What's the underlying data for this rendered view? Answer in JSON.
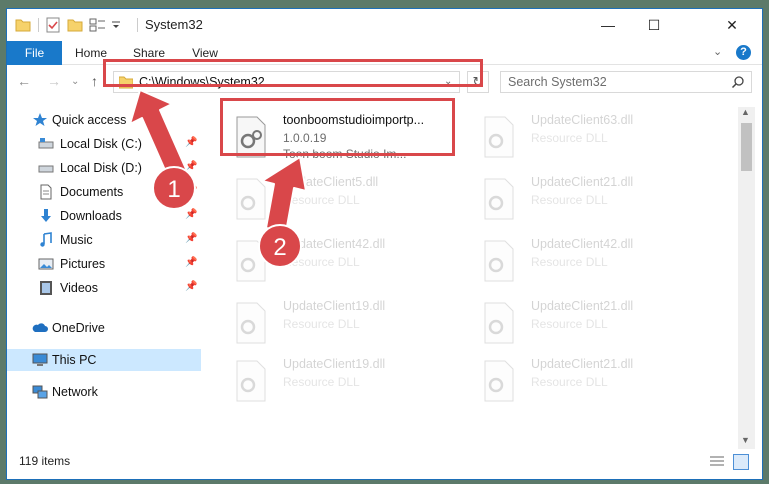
{
  "window": {
    "title": "System32",
    "minimize_glyph": "—",
    "maximize_glyph": "☐",
    "close_glyph": "✕"
  },
  "ribbon": {
    "tabs": [
      "File",
      "Home",
      "Share",
      "View"
    ],
    "collapse_glyph": "⌄",
    "help_glyph": "?"
  },
  "nav": {
    "back_glyph": "←",
    "forward_glyph": "→",
    "recent_glyph": "⌄",
    "up_glyph": "↑",
    "address": "C:\\Windows\\System32",
    "address_dropdown_glyph": "⌄",
    "refresh_glyph": "↻",
    "search_placeholder": "Search System32"
  },
  "sidebar": {
    "items": [
      {
        "label": "Quick access",
        "icon": "star-icon",
        "pinned": false
      },
      {
        "label": "Local Disk (C:)",
        "icon": "drive-icon",
        "pinned": true
      },
      {
        "label": "Local Disk (D:)",
        "icon": "drive-icon",
        "pinned": true
      },
      {
        "label": "Documents",
        "icon": "document-icon",
        "pinned": true
      },
      {
        "label": "Downloads",
        "icon": "download-icon",
        "pinned": true
      },
      {
        "label": "Music",
        "icon": "music-icon",
        "pinned": true
      },
      {
        "label": "Pictures",
        "icon": "picture-icon",
        "pinned": true
      },
      {
        "label": "Videos",
        "icon": "video-icon",
        "pinned": true
      },
      {
        "label": "OneDrive",
        "icon": "cloud-icon",
        "pinned": false
      },
      {
        "label": "This PC",
        "icon": "computer-icon",
        "pinned": false,
        "selected": true
      },
      {
        "label": "Network",
        "icon": "network-icon",
        "pinned": false
      }
    ],
    "pin_glyph": "📌"
  },
  "files": [
    {
      "name": "toonboomstudioimportp...",
      "line2": "1.0.0.19",
      "line3": "Toon boom Studio Im...",
      "highlighted": true
    },
    {
      "name": "UpdateClient63.dll",
      "line2": "Resource DLL",
      "line3": ""
    },
    {
      "name": "UpdateClient5.dll",
      "line2": "Resource DLL",
      "line3": ""
    },
    {
      "name": "UpdateClient21.dll",
      "line2": "Resource DLL",
      "line3": ""
    },
    {
      "name": "UpdateClient42.dll",
      "line2": "Resource DLL",
      "line3": ""
    },
    {
      "name": "UpdateClient42.dll",
      "line2": "Resource DLL",
      "line3": ""
    },
    {
      "name": "UpdateClient19.dll",
      "line2": "Resource DLL",
      "line3": ""
    },
    {
      "name": "UpdateClient21.dll",
      "line2": "Resource DLL",
      "line3": ""
    },
    {
      "name": "UpdateClient19.dll",
      "line2": "Resource DLL",
      "line3": ""
    },
    {
      "name": "UpdateClient21.dll",
      "line2": "Resource DLL",
      "line3": ""
    }
  ],
  "status": {
    "item_count": "119 items"
  },
  "callouts": [
    "1",
    "2"
  ],
  "colors": {
    "accent": "#1979ca",
    "highlight_red": "#d9474a",
    "selection": "#cce8ff"
  }
}
